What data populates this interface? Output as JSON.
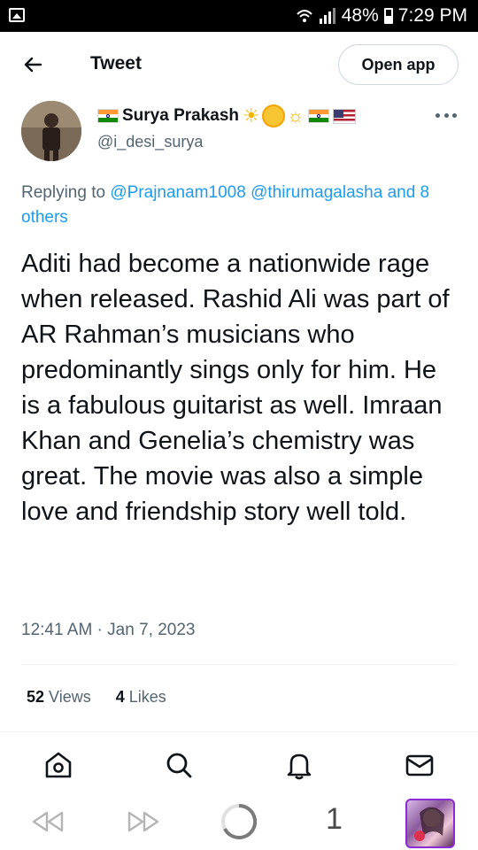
{
  "status_bar": {
    "battery": "48%",
    "time": "7:29 PM"
  },
  "header": {
    "title": "Tweet",
    "open_app_label": "Open app"
  },
  "author": {
    "name": "Surya Prakash",
    "handle": "@i_desi_surya"
  },
  "reply": {
    "prefix": "Replying to",
    "mention_1": "@Prajnanam1008",
    "mention_2": "@thirumagalasha",
    "and_word": "and",
    "others": "8 others"
  },
  "tweet": {
    "text": "Aditi had become a nationwide rage when released. Rashid Ali was part of AR Rahman’s musicians who predominantly sings only for him. He is a fabulous guitarist as well. Imraan Khan and Genelia’s chemistry was great. The movie was also a simple love and friendship story well told.",
    "timestamp": "12:41 AM · Jan 7, 2023"
  },
  "stats": {
    "views_count": "52",
    "views_label": "Views",
    "likes_count": "4",
    "likes_label": "Likes"
  },
  "browser": {
    "tab_count": "1"
  },
  "colors": {
    "link": "#1d9bf0",
    "secondary_text": "#536471",
    "primary_text": "#0f1419"
  }
}
